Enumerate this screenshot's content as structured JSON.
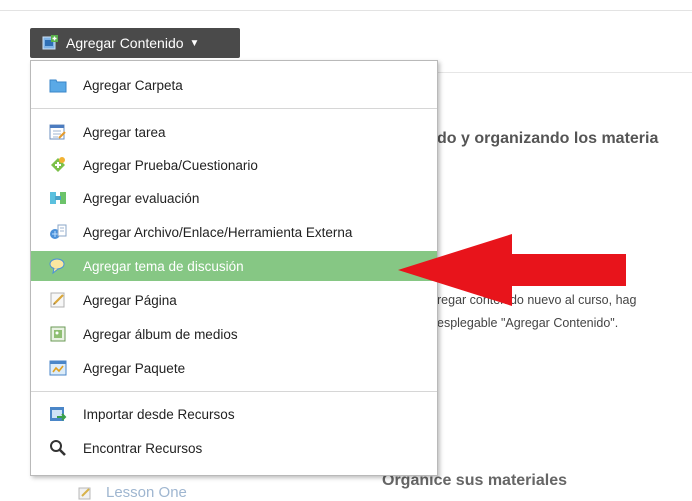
{
  "button": {
    "label": "Agregar Contenido",
    "caret": "▼",
    "icon": "add-content-icon"
  },
  "menu": {
    "items": [
      {
        "label": "Agregar Carpeta",
        "icon": "folder-icon"
      },
      {
        "label": "Agregar tarea",
        "icon": "assignment-icon"
      },
      {
        "label": "Agregar Prueba/Cuestionario",
        "icon": "quiz-icon"
      },
      {
        "label": "Agregar evaluación",
        "icon": "evaluation-icon"
      },
      {
        "label": "Agregar Archivo/Enlace/Herramienta Externa",
        "icon": "file-link-icon"
      },
      {
        "label": "Agregar tema de discusión",
        "icon": "discussion-icon",
        "highlighted": true
      },
      {
        "label": "Agregar Página",
        "icon": "page-icon"
      },
      {
        "label": "Agregar álbum de medios",
        "icon": "media-album-icon"
      },
      {
        "label": "Agregar Paquete",
        "icon": "package-icon"
      },
      {
        "label": "Importar desde Recursos",
        "icon": "import-icon"
      },
      {
        "label": "Encontrar Recursos",
        "icon": "search-icon"
      }
    ]
  },
  "background": {
    "heading": "do y organizando los materia",
    "para_line1": "regar contenido nuevo al curso, hag",
    "para_line2": "esplegable \"Agregar Contenido\".",
    "organice": "Organice sus materiales",
    "lesson": "Lesson One"
  },
  "colors": {
    "highlight": "#86c784",
    "arrow": "#e8141b",
    "button": "#4a4a4a"
  }
}
